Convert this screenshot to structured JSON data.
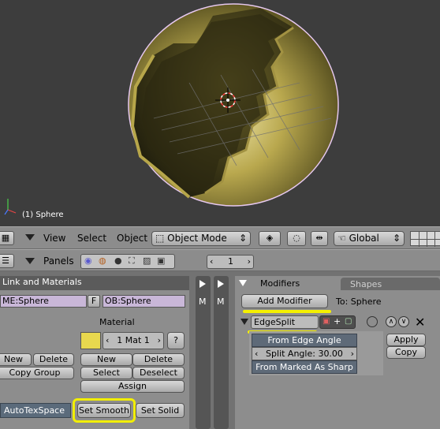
{
  "viewport": {
    "object_label": "(1) Sphere"
  },
  "header3d": {
    "view": "View",
    "select": "Select",
    "object": "Object",
    "mode": "Object Mode",
    "orientation": "Global"
  },
  "header_buttons": {
    "panels": "Panels",
    "frame": "1"
  },
  "link_materials": {
    "title": "Link and Materials",
    "mesh_name": "ME:Sphere",
    "fake_flag": "F",
    "object_name": "OB:Sphere",
    "material_label": "Material",
    "mat_slot": "1 Mat 1",
    "question": "?",
    "new_left": "New",
    "delete_left": "Delete",
    "copy_group": "Copy Group",
    "new": "New",
    "delete": "Delete",
    "select": "Select",
    "deselect": "Deselect",
    "assign": "Assign",
    "autotex": "AutoTexSpace",
    "set_smooth": "Set Smooth",
    "set_solid": "Set Solid",
    "colors": {
      "material_swatch": "#e8d84e",
      "highlight": "#f2ee00"
    }
  },
  "modifiers": {
    "tab_modifiers": "Modifiers",
    "tab_shapes": "Shapes",
    "add_modifier": "Add Modifier",
    "to_label": "To: Sphere",
    "modifier_name": "EdgeSplit",
    "from_edge_angle": "From Edge Angle",
    "split_angle": "Split Angle: 30.00",
    "from_marked_sharp": "From Marked As Sharp",
    "apply": "Apply",
    "copy": "Copy"
  },
  "side_strip": {
    "m1": "M",
    "m2": "M"
  }
}
